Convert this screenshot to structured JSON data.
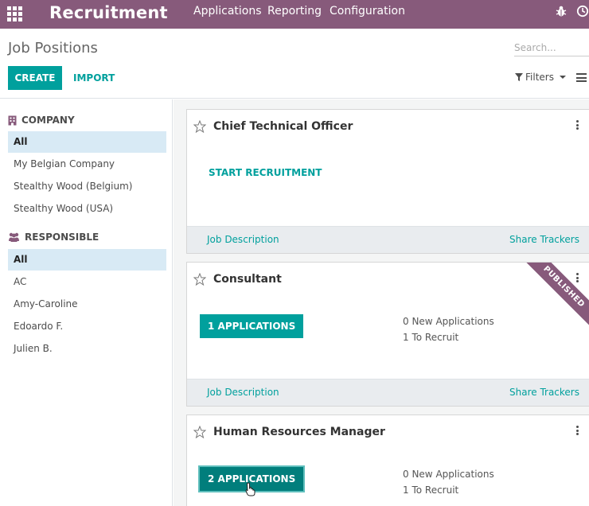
{
  "app": {
    "name": "Recruitment",
    "menu": [
      "Applications",
      "Reporting",
      "Configuration"
    ]
  },
  "control": {
    "title": "Job Positions",
    "search_placeholder": "Search...",
    "create_label": "CREATE",
    "import_label": "IMPORT",
    "filters_label": "Filters"
  },
  "sidebar": {
    "company_heading": "COMPANY",
    "companies": [
      "All",
      "My Belgian Company",
      "Stealthy Wood (Belgium)",
      "Stealthy Wood (USA)"
    ],
    "responsible_heading": "RESPONSIBLE",
    "responsibles": [
      "All",
      "AC",
      "Amy-Caroline",
      "Edoardo F.",
      "Julien B."
    ]
  },
  "jobs": [
    {
      "title": "Chief Technical Officer",
      "action": "START RECRUITMENT",
      "footer_left": "Job Description",
      "footer_right": "Share Trackers"
    },
    {
      "title": "Consultant",
      "action": "1 APPLICATIONS",
      "new_apps": "0 New Applications",
      "to_recruit": "1 To Recruit",
      "ribbon": "PUBLISHED",
      "footer_left": "Job Description",
      "footer_right": "Share Trackers"
    },
    {
      "title": "Human Resources Manager",
      "action": "2 APPLICATIONS",
      "new_apps": "0 New Applications",
      "to_recruit": "1 To Recruit"
    }
  ],
  "colors": {
    "brand": "#875a7b",
    "accent": "#00a09d",
    "active_filter": "#d8eaf5"
  }
}
